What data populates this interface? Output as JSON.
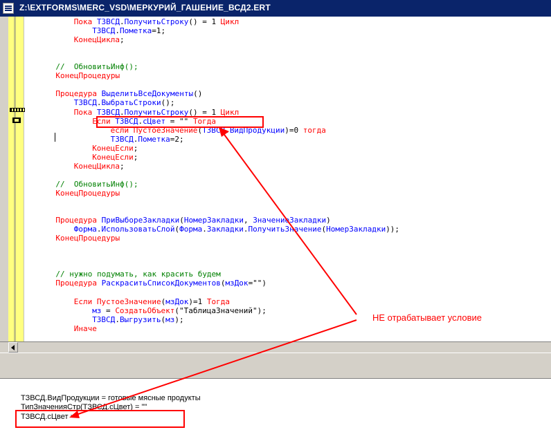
{
  "window": {
    "title": "Z:\\EXTFORMS\\MERC_VSD\\МЕРКУРИЙ_ГАШЕНИЕ_ВСД2.ERT"
  },
  "code": [
    {
      "indent": 8,
      "tokens": [
        {
          "t": "kw",
          "v": "Пока "
        },
        {
          "t": "id",
          "v": "ТЗВСД"
        },
        {
          "t": "str",
          "v": "."
        },
        {
          "t": "id",
          "v": "ПолучитьСтроку"
        },
        {
          "t": "str",
          "v": "() = 1 "
        },
        {
          "t": "kw",
          "v": "Цикл"
        }
      ]
    },
    {
      "indent": 12,
      "tokens": [
        {
          "t": "id",
          "v": "ТЗВСД"
        },
        {
          "t": "str",
          "v": "."
        },
        {
          "t": "id",
          "v": "Пометка"
        },
        {
          "t": "str",
          "v": "=1;"
        }
      ]
    },
    {
      "indent": 8,
      "tokens": [
        {
          "t": "kw",
          "v": "КонецЦикла"
        },
        {
          "t": "str",
          "v": ";"
        }
      ]
    },
    {
      "indent": 0,
      "tokens": []
    },
    {
      "indent": 0,
      "tokens": []
    },
    {
      "indent": 4,
      "tokens": [
        {
          "t": "cm",
          "v": "//  ОбновитьИнф();"
        }
      ]
    },
    {
      "indent": 4,
      "tokens": [
        {
          "t": "kw",
          "v": "КонецПроцедуры"
        }
      ]
    },
    {
      "indent": 0,
      "tokens": []
    },
    {
      "indent": 4,
      "tokens": [
        {
          "t": "kw",
          "v": "Процедура "
        },
        {
          "t": "id",
          "v": "ВыделитьВсеДокументы"
        },
        {
          "t": "str",
          "v": "()"
        }
      ]
    },
    {
      "indent": 8,
      "tokens": [
        {
          "t": "id",
          "v": "ТЗВСД"
        },
        {
          "t": "str",
          "v": "."
        },
        {
          "t": "id",
          "v": "ВыбратьСтроки"
        },
        {
          "t": "str",
          "v": "();"
        }
      ]
    },
    {
      "indent": 8,
      "tokens": [
        {
          "t": "kw",
          "v": "Пока "
        },
        {
          "t": "id",
          "v": "ТЗВСД"
        },
        {
          "t": "str",
          "v": "."
        },
        {
          "t": "id",
          "v": "ПолучитьСтроку"
        },
        {
          "t": "str",
          "v": "() = 1 "
        },
        {
          "t": "kw",
          "v": "Цикл"
        }
      ]
    },
    {
      "indent": 12,
      "tokens": [
        {
          "t": "kw",
          "v": "Если "
        },
        {
          "t": "id",
          "v": "ТЗВСД"
        },
        {
          "t": "str",
          "v": "."
        },
        {
          "t": "id",
          "v": "сЦвет"
        },
        {
          "t": "str",
          "v": " = \"\" "
        },
        {
          "t": "kw",
          "v": "Тогда"
        }
      ]
    },
    {
      "indent": 16,
      "tokens": [
        {
          "t": "kw",
          "v": "если "
        },
        {
          "t": "kw",
          "v": "ПустоеЗначение"
        },
        {
          "t": "str",
          "v": "("
        },
        {
          "t": "id",
          "v": "ТЗВСД"
        },
        {
          "t": "str",
          "v": "."
        },
        {
          "t": "id",
          "v": "ВидПродукции"
        },
        {
          "t": "str",
          "v": ")=0 "
        },
        {
          "t": "kw",
          "v": "тогда"
        }
      ]
    },
    {
      "indent": 16,
      "tokens": [
        {
          "t": "id",
          "v": "ТЗВСД"
        },
        {
          "t": "str",
          "v": "."
        },
        {
          "t": "id",
          "v": "Пометка"
        },
        {
          "t": "str",
          "v": "=2;"
        }
      ]
    },
    {
      "indent": 12,
      "tokens": [
        {
          "t": "kw",
          "v": "КонецЕсли"
        },
        {
          "t": "str",
          "v": ";"
        }
      ]
    },
    {
      "indent": 12,
      "tokens": [
        {
          "t": "kw",
          "v": "КонецЕсли"
        },
        {
          "t": "str",
          "v": ";"
        }
      ]
    },
    {
      "indent": 8,
      "tokens": [
        {
          "t": "kw",
          "v": "КонецЦикла"
        },
        {
          "t": "str",
          "v": ";"
        }
      ]
    },
    {
      "indent": 0,
      "tokens": []
    },
    {
      "indent": 4,
      "tokens": [
        {
          "t": "cm",
          "v": "//  ОбновитьИнф();"
        }
      ]
    },
    {
      "indent": 4,
      "tokens": [
        {
          "t": "kw",
          "v": "КонецПроцедуры"
        }
      ]
    },
    {
      "indent": 0,
      "tokens": []
    },
    {
      "indent": 0,
      "tokens": []
    },
    {
      "indent": 4,
      "tokens": [
        {
          "t": "kw",
          "v": "Процедура "
        },
        {
          "t": "id",
          "v": "ПриВыбореЗакладки"
        },
        {
          "t": "str",
          "v": "("
        },
        {
          "t": "id",
          "v": "НомерЗакладки"
        },
        {
          "t": "str",
          "v": ", "
        },
        {
          "t": "id",
          "v": "ЗначениеЗакладки"
        },
        {
          "t": "str",
          "v": ")"
        }
      ]
    },
    {
      "indent": 8,
      "tokens": [
        {
          "t": "id",
          "v": "Форма"
        },
        {
          "t": "str",
          "v": "."
        },
        {
          "t": "id",
          "v": "ИспользоватьСлой"
        },
        {
          "t": "str",
          "v": "("
        },
        {
          "t": "id",
          "v": "Форма"
        },
        {
          "t": "str",
          "v": "."
        },
        {
          "t": "id",
          "v": "Закладки"
        },
        {
          "t": "str",
          "v": "."
        },
        {
          "t": "id",
          "v": "ПолучитьЗначение"
        },
        {
          "t": "str",
          "v": "("
        },
        {
          "t": "id",
          "v": "НомерЗакладки"
        },
        {
          "t": "str",
          "v": "));"
        }
      ]
    },
    {
      "indent": 4,
      "tokens": [
        {
          "t": "kw",
          "v": "КонецПроцедуры"
        }
      ]
    },
    {
      "indent": 0,
      "tokens": []
    },
    {
      "indent": 0,
      "tokens": []
    },
    {
      "indent": 0,
      "tokens": []
    },
    {
      "indent": 4,
      "tokens": [
        {
          "t": "cm",
          "v": "// нужно подумать, как красить будем"
        }
      ]
    },
    {
      "indent": 4,
      "tokens": [
        {
          "t": "kw",
          "v": "Процедура "
        },
        {
          "t": "id",
          "v": "РаскраситьСписокДокументов"
        },
        {
          "t": "str",
          "v": "("
        },
        {
          "t": "id",
          "v": "мзДок"
        },
        {
          "t": "str",
          "v": "=\"\")"
        }
      ]
    },
    {
      "indent": 0,
      "tokens": []
    },
    {
      "indent": 8,
      "tokens": [
        {
          "t": "kw",
          "v": "Если "
        },
        {
          "t": "kw",
          "v": "ПустоеЗначение"
        },
        {
          "t": "str",
          "v": "("
        },
        {
          "t": "id",
          "v": "мзДок"
        },
        {
          "t": "str",
          "v": ")=1 "
        },
        {
          "t": "kw",
          "v": "Тогда"
        }
      ]
    },
    {
      "indent": 12,
      "tokens": [
        {
          "t": "id",
          "v": "мз"
        },
        {
          "t": "str",
          "v": " = "
        },
        {
          "t": "kw",
          "v": "СоздатьОбъект"
        },
        {
          "t": "str",
          "v": "(\"ТаблицаЗначений\");"
        }
      ]
    },
    {
      "indent": 12,
      "tokens": [
        {
          "t": "id",
          "v": "ТЗВСД"
        },
        {
          "t": "str",
          "v": "."
        },
        {
          "t": "id",
          "v": "Выгрузить"
        },
        {
          "t": "str",
          "v": "("
        },
        {
          "t": "id",
          "v": "мз"
        },
        {
          "t": "str",
          "v": ");"
        }
      ]
    },
    {
      "indent": 8,
      "tokens": [
        {
          "t": "kw",
          "v": "Иначе"
        }
      ]
    }
  ],
  "output": [
    "ТЗВСД.ВидПродукции = готовые мясные продукты",
    "ТипЗначенияСтр(ТЗВСД.сЦвет) = \"\"",
    "ТЗВСД.сЦвет = "
  ],
  "annotation": {
    "text": "НЕ отрабатывает условие",
    "color": "#ff0000"
  }
}
